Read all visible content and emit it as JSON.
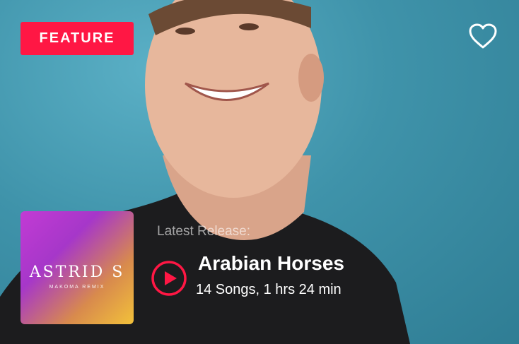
{
  "feature": {
    "badge_label": "FEATURE"
  },
  "icons": {
    "favorite": "heart-outline-icon",
    "play": "play-circle-icon"
  },
  "album": {
    "cover_title": "ASTRID S",
    "cover_subtitle": "MAKOMA REMIX",
    "latest_label": "Latest Release:",
    "title": "Arabian Horses",
    "meta": "14 Songs, 1 hrs 24 min"
  },
  "colors": {
    "accent": "#ff1744",
    "background": "#3f93aa"
  }
}
